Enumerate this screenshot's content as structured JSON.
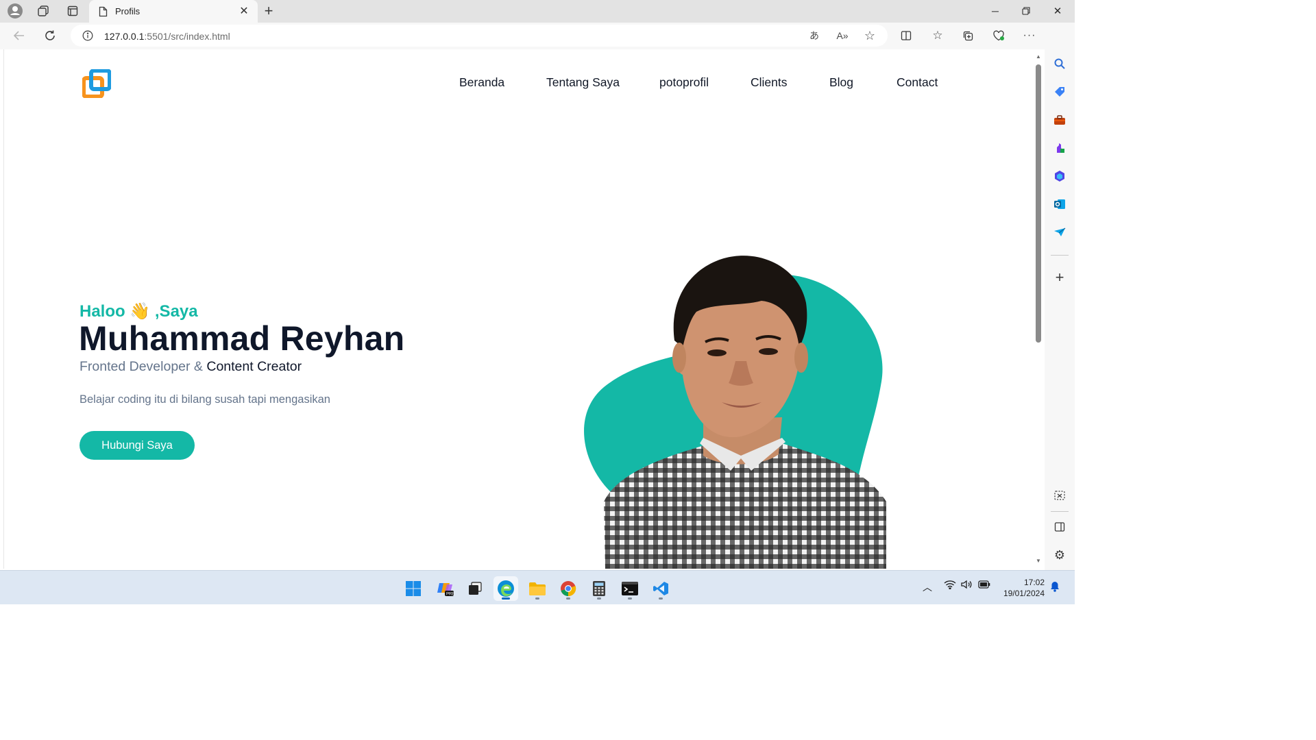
{
  "browser": {
    "tab_title": "Profils",
    "url_host": "127.0.0.1",
    "url_path": ":5501/src/index.html"
  },
  "page": {
    "nav": [
      "Beranda",
      "Tentang Saya",
      "potoprofil",
      "Clients",
      "Blog",
      "Contact"
    ],
    "greeting": "Haloo 👋 ,Saya",
    "name": "Muhammad Reyhan",
    "role_prefix": "Fronted Developer & ",
    "role_highlight": "Content Creator",
    "tagline": "Belajar coding itu di bilang susah tapi mengasikan",
    "cta_label": "Hubungi Saya"
  },
  "taskbar": {
    "time": "17:02",
    "date": "19/01/2024"
  },
  "colors": {
    "accent": "#14b8a6",
    "heading": "#0f172a",
    "muted": "#64748b",
    "logo_orange": "#f7931e",
    "logo_blue": "#1e9be0"
  }
}
